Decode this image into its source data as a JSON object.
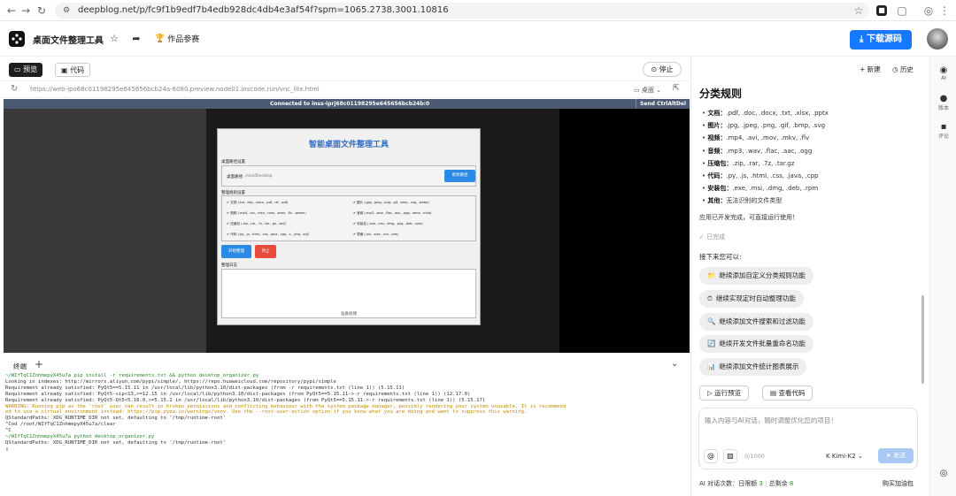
{
  "browser": {
    "url": "deepblog.net/p/fc9f1b9edf7b4edb928dc4db4e3af54f?spm=1065.2738.3001.10816"
  },
  "header": {
    "title": "桌面文件整理工具",
    "award_label": "作品参赛",
    "download_label": "下载源码"
  },
  "toolbar": {
    "preview_tab": "预览",
    "code_tab": "代码",
    "stop_label": "停止",
    "preview_url": "https://web-ipo68c01198295e645656bcb24a-6080.preview.node01.inscode.run/vnc_lite.html",
    "desktop_label": "桌面",
    "vnc_status": "Connected to inss-iprj68c01198295e645656bcb24b:0",
    "send_ctrl_alt_del": "Send CtrlAltDel"
  },
  "app_window": {
    "title": "智能桌面文件整理工具",
    "desktop_group": "桌面路径设置",
    "desktop_path_label": "桌面路径:",
    "desktop_path_value": "/root/Desktop",
    "change_path_btn": "更改路径",
    "rules_group": "整理规则设置",
    "rules": [
      "文档 (.txt, .doc, .docx, .pdf, .rtf, .odt)",
      "图片 (.jpg, .jpeg, .png, .gif, .bmp, .svg, .webp)",
      "视频 (.mp4, .avi, .mkv, .mov, .wmv, .flv, .webm)",
      "音频 (.mp3, .wav, .flac, .aac, .ogg, .wma, .m4a)",
      "压缩包 (.zip, .rar, .7z, .tar, .gz, .bz2)",
      "安装包 (.exe, .msi, .dmg, .pkg, .deb, .rpm)",
      "代码 (.py, .js, .html, .css, .java, .cpp, .c, .php, .sql)",
      "表格 (.xls, .xlsx, .csv, .ods)"
    ],
    "start_btn": "开始整理",
    "stop_btn": "停止",
    "log_group": "整理日志",
    "status": "准备就绪"
  },
  "terminal": {
    "tab_label": "终端",
    "lines": [
      {
        "cls": "green",
        "text": "~/WIfTqC1ZnhmepyX45u7a pip install -r requirements.txt && python desktop_organizer.py"
      },
      {
        "cls": "",
        "text": "Looking in indexes: http://mirrors.aliyun.com/pypi/simple/, https://repo.huaweicloud.com/repository/pypi/simple"
      },
      {
        "cls": "",
        "text": "Requirement already satisfied: PyQt5==5.15.11 in /usr/local/lib/python3.10/dist-packages (from -r requirements.txt (line 1)) (5.15.11)"
      },
      {
        "cls": "",
        "text": "Requirement already satisfied: PyQt5-sip<13,>=12.15 in /usr/local/lib/python3.10/dist-packages (from PyQt5==5.15.11->-r requirements.txt (line 1)) (12.17.0)"
      },
      {
        "cls": "",
        "text": "Requirement already satisfied: PyQt5-Qt5<5.16.0,>=5.15.2 in /usr/local/lib/python3.10/dist-packages (from PyQt5==5.15.11->-r requirements.txt (line 1)) (5.15.17)"
      },
      {
        "cls": "warn",
        "text": "WARNING: Running pip as the 'root' user can result in broken permissions and conflicting behaviour with the system package manager, possibly rendering your system unusable. It is recommend"
      },
      {
        "cls": "warn",
        "text": "ed to use a virtual environment instead: https://pip.pypa.io/warnings/venv. Use the --root-user-action option if you know what you are doing and want to suppress this warning."
      },
      {
        "cls": "",
        "text": "QStandardPaths: XDG_RUNTIME_DIR not set, defaulting to '/tmp/runtime-root'"
      },
      {
        "cls": "",
        "text": "^Cod /root/WIfTqC1ZnhmepyX45u7a/clear"
      },
      {
        "cls": "",
        "text": "^C"
      },
      {
        "cls": "green",
        "text": "~/WIfTqC1ZnhmepyX45u7a python desktop_organizer.py"
      },
      {
        "cls": "",
        "text": "QStandardPaths: XDG_RUNTIME_DIR not set, defaulting to '/tmp/runtime-root'"
      },
      {
        "cls": "",
        "text": "▯"
      }
    ]
  },
  "right_panel": {
    "new_label": "新建",
    "history_label": "历史",
    "section_title": "分类规则",
    "bullets": [
      {
        "k": "文档：",
        "v": ".pdf, .doc, .docx, .txt, .xlsx, .pptx"
      },
      {
        "k": "图片：",
        "v": ".jpg, .jpeg, .png, .gif, .bmp, .svg"
      },
      {
        "k": "视频：",
        "v": ".mp4, .avi, .mov, .mkv, .flv"
      },
      {
        "k": "音频：",
        "v": ".mp3, .wav, .flac, .aac, .ogg"
      },
      {
        "k": "压缩包：",
        "v": ".zip, .rar, .7z, .tar.gz"
      },
      {
        "k": "代码：",
        "v": ".py, .js, .html, .css, .java, .cpp"
      },
      {
        "k": "安装包：",
        "v": ".exe, .msi, .dmg, .deb, .rpm"
      },
      {
        "k": "其他：",
        "v": "无法识别的文件类型"
      }
    ],
    "complete_msg": "应用已开发完成，可直接运行使用！",
    "done_label": "已完成",
    "next_label": "接下来您可以:",
    "suggestions": [
      {
        "icon": "📁",
        "text": "继续添加自定义分类规则功能"
      },
      {
        "icon": "⏱",
        "text": "继续实现定时自动整理功能"
      },
      {
        "icon": "🔍",
        "text": "继续添加文件搜索和过滤功能"
      },
      {
        "icon": "🔄",
        "text": "继续开发文件批量重命名功能"
      },
      {
        "icon": "📊",
        "text": "继续添加文件统计图表展示"
      }
    ],
    "run_preview_btn": "运行预览",
    "view_code_btn": "查看代码",
    "input_placeholder": "输入内容与AI对话，随时调整优化您的项目！",
    "char_count": "0/1000",
    "model": "Kimi-K2",
    "send_label": "发送",
    "quota_prefix": "AI 对话次数：日限额",
    "quota_limit": "3",
    "quota_remaining_label": "总剩余",
    "quota_remaining": "8",
    "buy_label": "购买加油包"
  },
  "rail": {
    "ai_label": "AI",
    "version_label": "版本",
    "comment_label": "评论"
  }
}
